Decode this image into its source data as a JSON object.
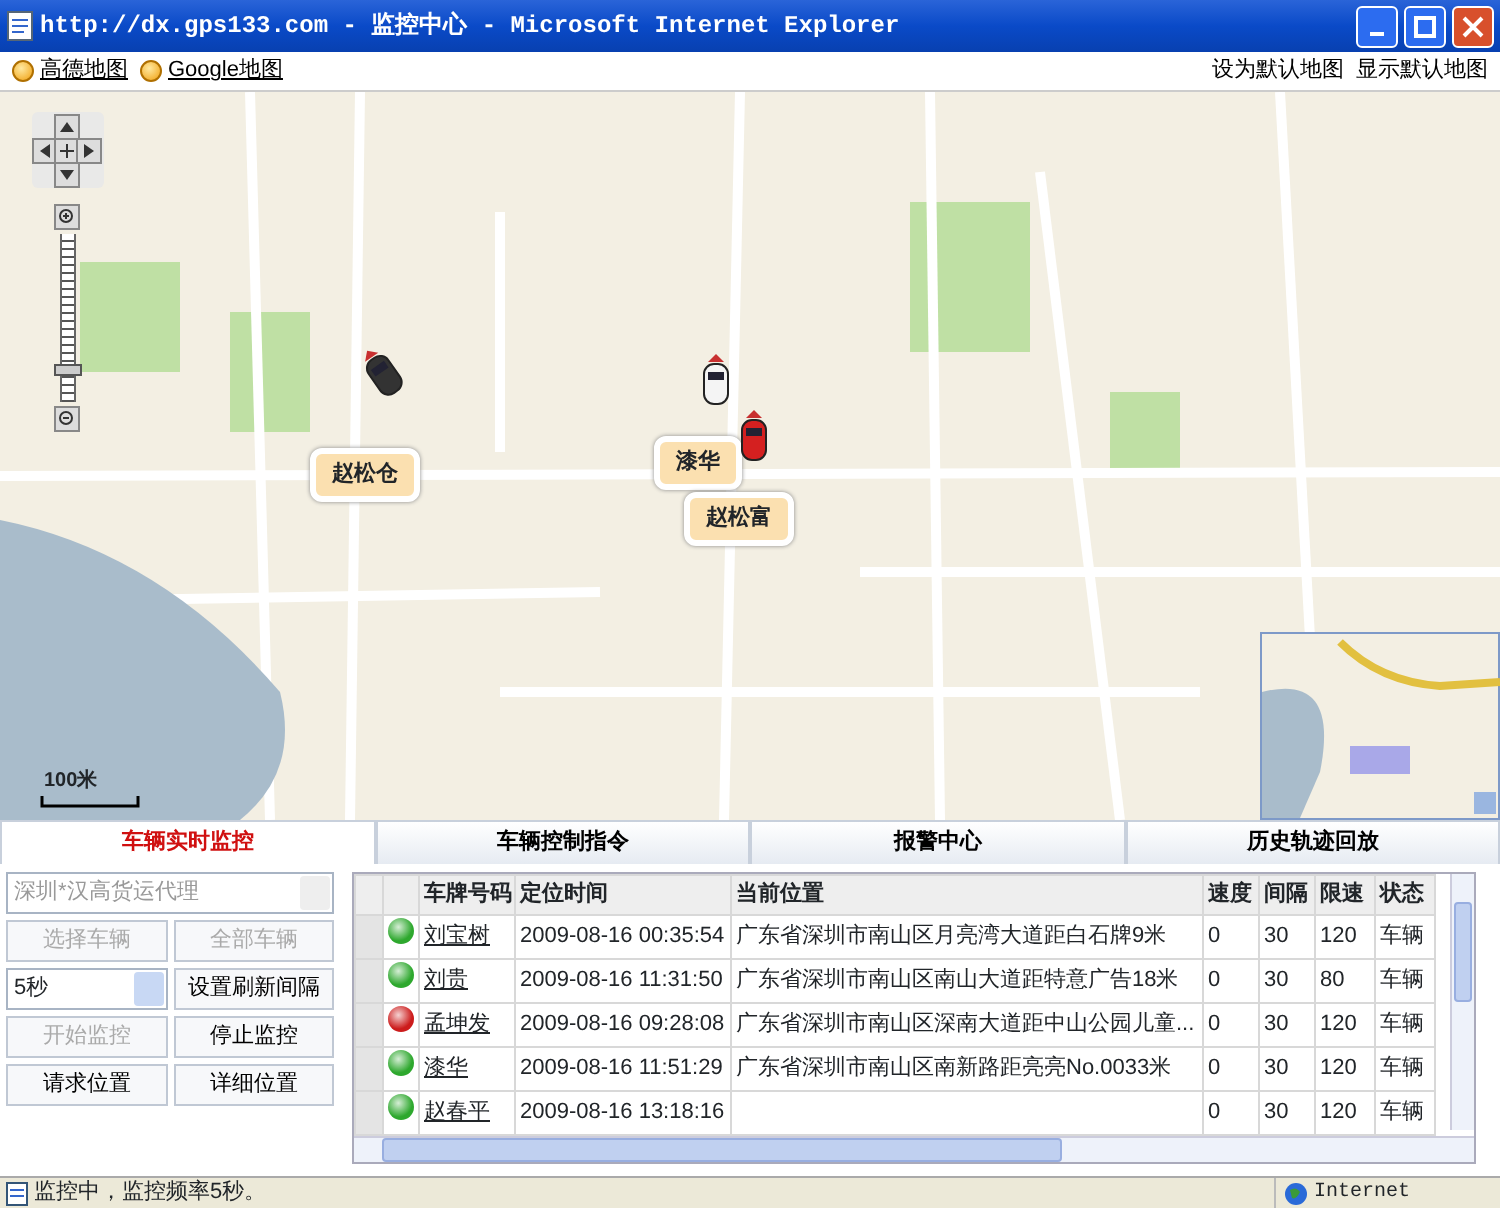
{
  "window": {
    "title": "http://dx.gps133.com - 监控中心 - Microsoft Internet Explorer"
  },
  "map_sources": [
    {
      "label": "高德地图"
    },
    {
      "label": "Google地图"
    }
  ],
  "map_actions": [
    "设为默认地图",
    "显示默认地图"
  ],
  "map": {
    "scale": "100米",
    "zoom": {
      "level": 0.15
    },
    "vehicles": [
      {
        "label": "赵松仓",
        "color": "#333333"
      },
      {
        "label": "漆华",
        "color": "#f4f4f4"
      },
      {
        "label": "赵松富",
        "color": "#d42020"
      }
    ]
  },
  "tabs": [
    {
      "label": "车辆实时监控",
      "selected": true
    },
    {
      "label": "车辆控制指令",
      "selected": false
    },
    {
      "label": "报警中心",
      "selected": false
    },
    {
      "label": "历史轨迹回放",
      "selected": false
    }
  ],
  "controls": [
    {
      "kind": "select-wide",
      "value": "深圳*汉高货运代理",
      "disabled": true
    },
    {
      "kind": "button",
      "label": "选择车辆",
      "disabled": true
    },
    {
      "kind": "button",
      "label": "全部车辆",
      "disabled": true
    },
    {
      "kind": "select",
      "value": "5秒",
      "disabled": false
    },
    {
      "kind": "button",
      "label": "设置刷新间隔",
      "disabled": false
    },
    {
      "kind": "button",
      "label": "开始监控",
      "disabled": true
    },
    {
      "kind": "button",
      "label": "停止监控",
      "disabled": false
    },
    {
      "kind": "button",
      "label": "请求位置",
      "disabled": false
    },
    {
      "kind": "button",
      "label": "详细位置",
      "disabled": false
    }
  ],
  "table": {
    "columns": [
      "车牌号码",
      "定位时间",
      "当前位置",
      "速度",
      "间隔",
      "限速",
      "状态"
    ],
    "rows": [
      {
        "color": "#2ea82e",
        "cells": [
          "刘宝树",
          "2009-08-16 00:35:54",
          "广东省深圳市南山区月亮湾大道距白石牌9米",
          "0",
          "30",
          "120",
          "车辆"
        ]
      },
      {
        "color": "#2ea82e",
        "cells": [
          "刘贵",
          "2009-08-16 11:31:50",
          "广东省深圳市南山区南山大道距特意广告18米",
          "0",
          "30",
          "80",
          "车辆"
        ]
      },
      {
        "color": "#cc1c1c",
        "cells": [
          "孟坤发",
          "2009-08-16 09:28:08",
          "广东省深圳市南山区深南大道距中山公园儿童...",
          "0",
          "30",
          "120",
          "车辆"
        ]
      },
      {
        "color": "#2ea82e",
        "cells": [
          "漆华",
          "2009-08-16 11:51:29",
          "广东省深圳市南山区南新路距亮亮No.0033米",
          "0",
          "30",
          "120",
          "车辆"
        ]
      },
      {
        "color": "#2ea82e",
        "cells": [
          "赵春平",
          "2009-08-16 13:18:16",
          "",
          "0",
          "30",
          "120",
          "车辆"
        ]
      }
    ]
  },
  "status_bar": {
    "text": "监控中，监控频率5秒。",
    "zone": "Internet"
  }
}
